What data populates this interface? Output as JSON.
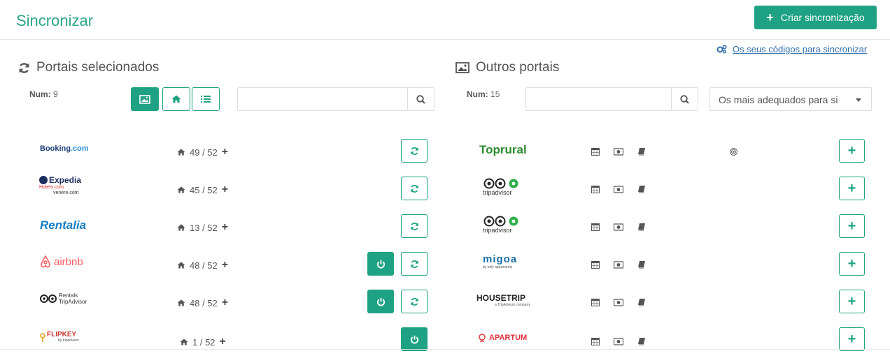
{
  "header": {
    "title": "Sincronizar",
    "create_button": "Criar sincronização"
  },
  "codes_link": "Os seus códigos para sincronizar",
  "selected": {
    "title": "Portais selecionados",
    "num_label": "Num:",
    "num_value": "9",
    "search_placeholder": "",
    "portals": [
      {
        "name": "Booking.com",
        "count": "49 / 52",
        "power": false,
        "sync": true
      },
      {
        "name": "Expedia",
        "count": "45 / 52",
        "power": false,
        "sync": true
      },
      {
        "name": "Rentalia",
        "count": "13 / 52",
        "power": false,
        "sync": true
      },
      {
        "name": "airbnb",
        "count": "48 / 52",
        "power": true,
        "sync": true
      },
      {
        "name": "Rentals TripAdvisor",
        "count": "48 / 52",
        "power": true,
        "sync": true
      },
      {
        "name": "FLIPKEY",
        "count": "1 / 52",
        "power": true,
        "sync": false
      }
    ]
  },
  "others": {
    "title": "Outros portais",
    "num_label": "Num:",
    "num_value": "15",
    "search_placeholder": "",
    "sort_selected": "Os mais adequados para si",
    "portals": [
      {
        "name": "Toprural",
        "target": true
      },
      {
        "name": "tripadvisor",
        "target": false
      },
      {
        "name": "tripadvisor",
        "target": false
      },
      {
        "name": "migoa",
        "target": false
      },
      {
        "name": "HOUSETRIP",
        "target": false
      },
      {
        "name": "APARTUM",
        "target": false
      }
    ]
  },
  "logo_text": {
    "booking_a": "Booking",
    "booking_b": ".com",
    "expedia": "Expedia",
    "expedia_hotels": "Hotels.com",
    "expedia_venere": "venere.com",
    "rentalia": "Rentalia",
    "airbnb": "airbnb",
    "tripadv_rentals": "Rentals",
    "tripadv_sub": "TripAdvisor",
    "flipkey": "FLIPKEY",
    "flipkey_sub": "by tripadvisor",
    "toprural": "Toprural",
    "tripadvisor": "tripadvisor",
    "migoa": "migoa",
    "migoa_sub": "by only apartments",
    "housetrip": "HOUSETRIP",
    "housetrip_sub": "a TripAdvisor company",
    "apartum": "APARTUM"
  },
  "colors": {
    "accent": "#1fa283",
    "title": "#2aa58a",
    "link": "#2f6fae"
  }
}
